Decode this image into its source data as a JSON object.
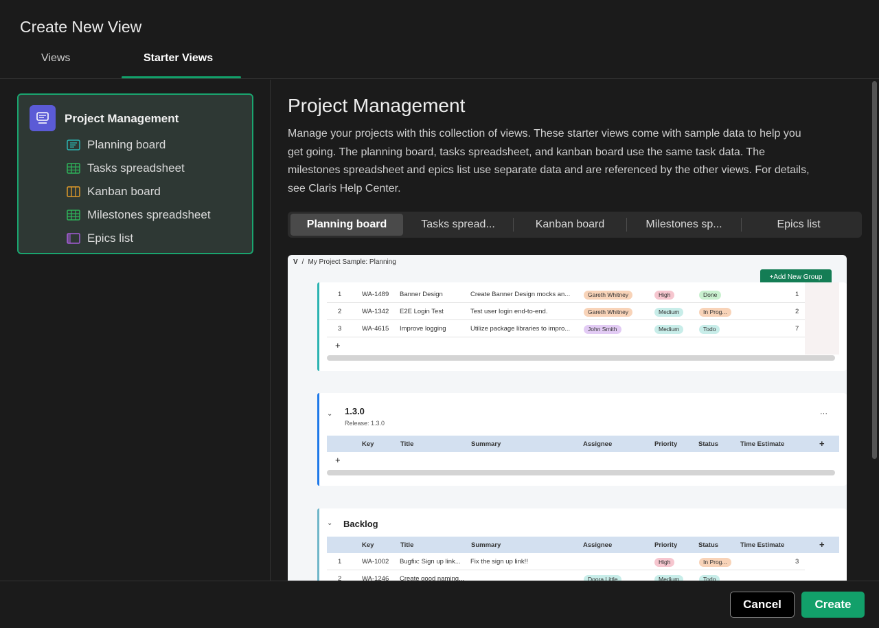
{
  "dialog": {
    "title": "Create New View",
    "tabs": [
      {
        "label": "Views",
        "active": false
      },
      {
        "label": "Starter Views",
        "active": true
      }
    ]
  },
  "sidebar": {
    "card_title": "Project Management",
    "items": [
      {
        "label": "Planning board",
        "icon": "planning-board-icon",
        "color": "#2bb3b1"
      },
      {
        "label": "Tasks spreadsheet",
        "icon": "spreadsheet-icon",
        "color": "#2eb35a"
      },
      {
        "label": "Kanban board",
        "icon": "kanban-icon",
        "color": "#e19b2a"
      },
      {
        "label": "Milestones spreadsheet",
        "icon": "spreadsheet-icon",
        "color": "#2eb35a"
      },
      {
        "label": "Epics list",
        "icon": "list-icon",
        "color": "#a45cd6"
      }
    ]
  },
  "main": {
    "title": "Project Management",
    "description": "Manage your projects with this collection of views. These starter views come with sample data to help you get going. The planning board, tasks spreadsheet, and kanban board use the same task data. The milestones spreadsheet and epics list use separate data and are referenced by the other views. For details, see Claris Help Center.",
    "segments": [
      {
        "label": "Planning board",
        "active": true
      },
      {
        "label": "Tasks spread...",
        "active": false
      },
      {
        "label": "Kanban board",
        "active": false
      },
      {
        "label": "Milestones sp...",
        "active": false
      },
      {
        "label": "Epics list",
        "active": false
      }
    ]
  },
  "preview": {
    "breadcrumb": "My Project Sample: Planning",
    "add_group": "+Add New Group",
    "columns": {
      "key": "Key",
      "title": "Title",
      "summary": "Summary",
      "assignee": "Assignee",
      "priority": "Priority",
      "status": "Status",
      "time_estimate": "Time Estimate"
    },
    "group1_rows": [
      {
        "n": "1",
        "key": "WA-1489",
        "title": "Banner Design",
        "summary": "Create Banner Design mocks an...",
        "assignee": "Gareth Whitney",
        "priority": "High",
        "status": "Done",
        "est": "1"
      },
      {
        "n": "2",
        "key": "WA-1342",
        "title": "E2E Login Test",
        "summary": "Test user login end-to-end.",
        "assignee": "Gareth Whitney",
        "priority": "Medium",
        "status": "In Prog...",
        "est": "2"
      },
      {
        "n": "3",
        "key": "WA-4615",
        "title": "Improve logging",
        "summary": "Utilize package libraries to impro...",
        "assignee": "John Smith",
        "priority": "Medium",
        "status": "Todo",
        "est": "7"
      }
    ],
    "group2": {
      "title": "1.3.0",
      "subtitle": "Release: 1.3.0"
    },
    "group3": {
      "title": "Backlog",
      "rows": [
        {
          "n": "1",
          "key": "WA-1002",
          "title": "Bugfix: Sign up link...",
          "summary": "Fix the sign up link!!",
          "assignee": "",
          "priority": "High",
          "status": "In Prog...",
          "est": "3"
        },
        {
          "n": "2",
          "key": "WA-1246",
          "title": "Create good naming...",
          "summary": "",
          "assignee": "Doora Little",
          "priority": "Medium",
          "status": "Todo",
          "est": ""
        }
      ]
    },
    "plus": "+",
    "more": "···",
    "chev": "⌄"
  },
  "footer": {
    "cancel": "Cancel",
    "create": "Create"
  },
  "colors": {
    "accent": "#12a06a",
    "pm_icon_bg": "#5b5bd6"
  }
}
